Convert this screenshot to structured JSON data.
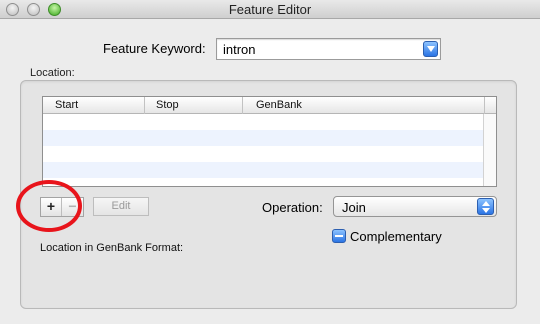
{
  "window": {
    "title": "Feature Editor",
    "buttons": [
      "close",
      "minimize",
      "zoom"
    ]
  },
  "feature": {
    "keyword_label": "Feature Keyword:",
    "keyword_value": "intron"
  },
  "location": {
    "section_label": "Location:",
    "table": {
      "columns": [
        "Start",
        "Stop",
        "GenBank"
      ],
      "rows": []
    },
    "add_button": "+",
    "remove_button": "−",
    "edit_button": "Edit",
    "operation_label": "Operation:",
    "operation_value": "Join",
    "complementary_label": "Complementary",
    "complementary_state": "mixed",
    "genbank_format_label": "Location in GenBank Format:",
    "genbank_format_value": ""
  },
  "annotation": {
    "highlight_color": "#e8141b"
  }
}
